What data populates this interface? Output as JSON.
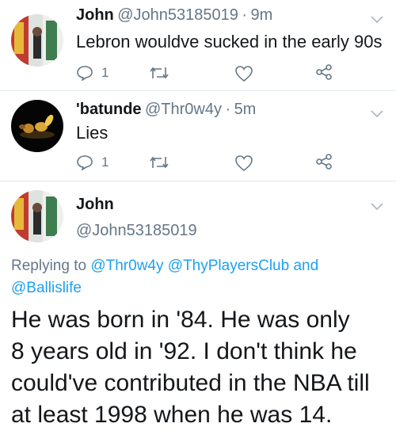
{
  "colors": {
    "link": "#1da1f2",
    "muted": "#657786",
    "text": "#14171a",
    "divider": "#e1e8ed"
  },
  "tweets": [
    {
      "name": "John",
      "handle": "@John53185019",
      "sep": "·",
      "time": "9m",
      "text": "Lebron wouldve sucked in the early 90s",
      "reply_count": "1"
    },
    {
      "name": "'batunde",
      "handle": "@Thr0w4y",
      "sep": "·",
      "time": "5m",
      "text": "Lies",
      "reply_count": "1"
    }
  ],
  "detail": {
    "name": "John",
    "handle": "@John53185019",
    "replying_prefix": "Replying to",
    "mention_1": "@Thr0w4y",
    "mention_2": "@ThyPlayersClub",
    "and": "and",
    "mention_3": "@Ballislife",
    "text_lines": [
      "He was born in '84. He was only",
      "8 years old in '92. I don't think he",
      "could've contributed in the NBA till",
      "at least 1998 when he was 14."
    ]
  },
  "icons": {
    "reply": "reply-icon",
    "retweet": "retweet-icon",
    "like": "heart-icon",
    "share": "share-icon",
    "menu": "chevron-down-icon"
  }
}
